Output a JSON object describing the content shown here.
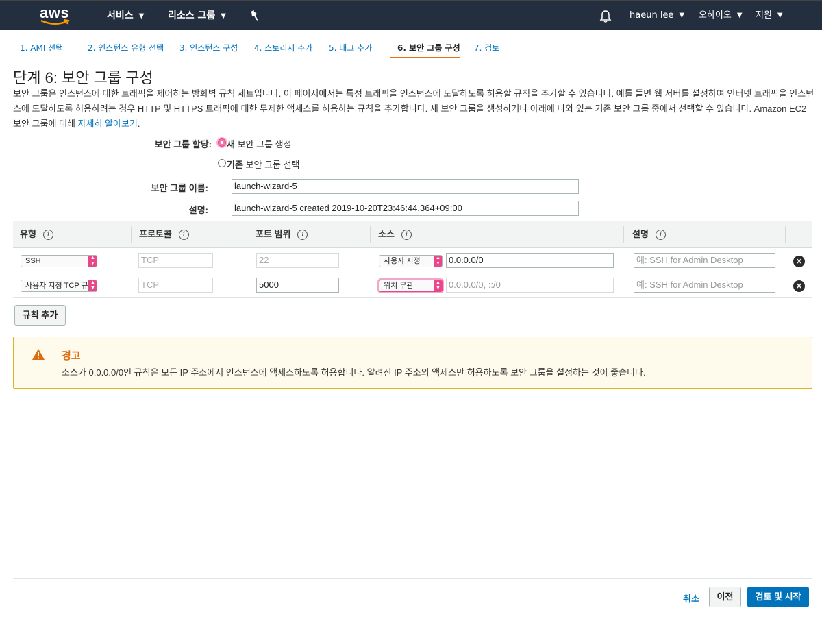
{
  "nav": {
    "logo": "aws",
    "services": "서비스",
    "resource_groups": "리소스 그룹",
    "user": "haeun lee",
    "region": "오하이오",
    "support": "지원"
  },
  "wizard_tabs": [
    {
      "label": "1. AMI 선택"
    },
    {
      "label": "2. 인스턴스 유형 선택"
    },
    {
      "label": "3. 인스턴스 구성"
    },
    {
      "label": "4. 스토리지 추가"
    },
    {
      "label": "5. 태그 추가"
    },
    {
      "label": "6. 보안 그룹 구성",
      "active": true
    },
    {
      "label": "7. 검토"
    }
  ],
  "page": {
    "title": "단계 6: 보안 그룹 구성",
    "description": "보안 그룹은 인스턴스에 대한 트래픽을 제어하는 방화벽 규칙 세트입니다. 이 페이지에서는 특정 트래픽을 인스턴스에 도달하도록 허용할 규칙을 추가할 수 있습니다. 예를 들면 웹 서버를 설정하여 인터넷 트래픽을 인스턴스에 도달하도록 허용하려는 경우 HTTP 및 HTTPS 트래픽에 대한 무제한 액세스를 허용하는 규칙을 추가합니다. 새 보안 그룹을 생성하거나 아래에 나와 있는 기존 보안 그룹 중에서 선택할 수 있습니다. Amazon EC2 보안 그룹에 대해 ",
    "learn_more": "자세히 알아보기",
    "desc_end": "."
  },
  "form": {
    "assign_label": "보안 그룹 할당:",
    "option_new_bold": "새",
    "option_new_rest": " 보안 그룹 생성",
    "option_existing_bold": "기존",
    "option_existing_rest": " 보안 그룹 선택",
    "name_label": "보안 그룹 이름:",
    "name_value": "launch-wizard-5",
    "desc_label": "설명:",
    "desc_value": "launch-wizard-5 created 2019-10-20T23:46:44.364+09:00"
  },
  "table": {
    "headers": [
      "유형",
      "프로토콜",
      "포트 범위",
      "소스",
      "설명"
    ],
    "info": "i",
    "rows": [
      {
        "type": "SSH",
        "protocol": "TCP",
        "port": "22",
        "source_type": "사용자 지정",
        "source": "0.0.0.0/0",
        "source_placeholder": "",
        "desc_placeholder": "예: SSH for Admin Desktop"
      },
      {
        "type": "사용자 지정 TCP 규칙",
        "protocol": "TCP",
        "port": "5000",
        "source_type": "위치 무관",
        "source": "",
        "source_placeholder": "0.0.0.0/0, ::/0",
        "desc_placeholder": "예: SSH for Admin Desktop"
      }
    ],
    "add_rule": "규칙 추가"
  },
  "warning": {
    "title": "경고",
    "text": "소스가 0.0.0.0/0인 규칙은 모든 IP 주소에서 인스턴스에 액세스하도록 허용합니다. 알려진 IP 주소의 액세스만 허용하도록 보안 그룹을 설정하는 것이 좋습니다."
  },
  "footer": {
    "cancel": "취소",
    "previous": "이전",
    "review_launch": "검토 및 시작"
  },
  "colors": {
    "nav_bg": "#232f3e",
    "accent": "#ec7211",
    "link": "#0073bb",
    "focus": "#e8488a"
  }
}
